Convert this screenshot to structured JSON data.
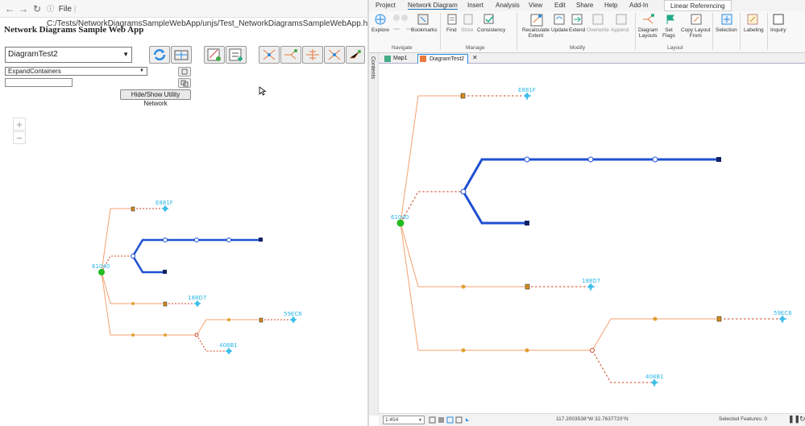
{
  "browser": {
    "back": "←",
    "forward": "→",
    "reload": "↻",
    "file_label": "File",
    "url": "C:/Tests/NetworkDiagramsSampleWebApp/unjs/Test_NetworkDiagramsSampleWebApp.html"
  },
  "app": {
    "title": "Network Diagrams Sample Web App",
    "diagram_select": "DiagramTest2",
    "layout_select": "ExpandContainers",
    "text_input": "",
    "hide_show_label": "Hide/Show Utility Network",
    "zoom_in": "+",
    "zoom_out": "−"
  },
  "pro": {
    "menu": [
      "Project",
      "Network Diagram",
      "Insert",
      "Analysis",
      "View",
      "Edit",
      "Share",
      "Help",
      "Add-In"
    ],
    "contextual_tab": "Linear Referencing",
    "ribbon": {
      "explore": "Explore",
      "bookmarks": "Bookmarks",
      "navigate": "Navigate",
      "find": "Find",
      "store": "Store",
      "consistency": "Consistency",
      "manage": "Manage",
      "recalculate1": "Recalculate",
      "recalculate2": "Extent",
      "update": "Update",
      "extend": "Extend",
      "overwrite": "Overwrite",
      "append": "Append",
      "modify": "Modify",
      "diagram_layouts1": "Diagram",
      "diagram_layouts2": "Layouts",
      "set_flags1": "Set",
      "set_flags2": "Flags",
      "copy_layout1": "Copy Layout",
      "copy_layout2": "From",
      "layout": "Layout",
      "selection": "Selection",
      "labeling": "Labeling",
      "inquiry": "Inquiry"
    },
    "contents": "Contents",
    "tabs": [
      "Map1",
      "DiagramTest2"
    ],
    "status": {
      "scale": "1:454",
      "coords": "117.2003538°W 32.7637720°N",
      "selected": "Selected Features: 0"
    }
  },
  "diagram": {
    "labels": [
      "61040",
      "E881F",
      "188D7",
      "59EC6",
      "408B1"
    ],
    "colors": {
      "thick": "#1e50d2",
      "orange": "#f5a070",
      "dash": "#cc4422",
      "label": "#29b6e8",
      "root": "#22bb22"
    }
  }
}
